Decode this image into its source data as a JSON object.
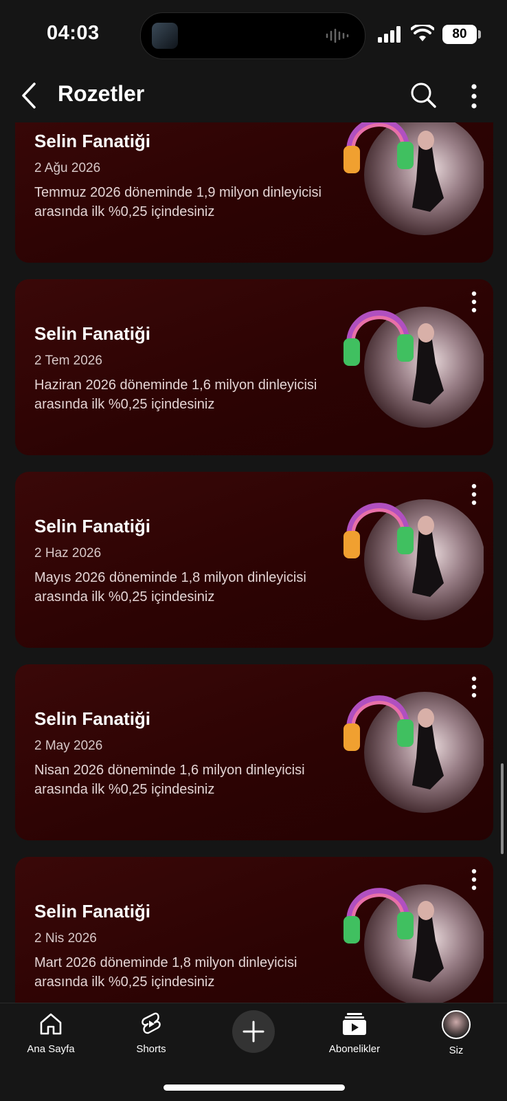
{
  "status_bar": {
    "time": "04:03",
    "battery": "80"
  },
  "header": {
    "title": "Rozetler",
    "back_icon": "chevron-left-icon",
    "search_icon": "search-icon",
    "more_icon": "more-vertical-icon"
  },
  "badges": [
    {
      "title": "Selin Fanatiği",
      "date": "2 Ağu 2026",
      "description": "Temmuz 2026 döneminde 1,9 milyon dinleyicisi arasında ilk %0,25 içindesiniz"
    },
    {
      "title": "Selin Fanatiği",
      "date": "2 Tem 2026",
      "description": "Haziran 2026 döneminde 1,6 milyon dinleyicisi arasında ilk %0,25 içindesiniz"
    },
    {
      "title": "Selin Fanatiği",
      "date": "2 Haz 2026",
      "description": "Mayıs 2026 döneminde 1,8 milyon dinleyicisi arasında ilk %0,25 içindesiniz"
    },
    {
      "title": "Selin Fanatiği",
      "date": "2 May 2026",
      "description": "Nisan 2026 döneminde 1,6 milyon dinleyicisi arasında ilk %0,25 içindesiniz"
    },
    {
      "title": "Selin Fanatiği",
      "date": "2 Nis 2026",
      "description": "Mart 2026 döneminde 1,8 milyon dinleyicisi arasında ilk %0,25 içindesiniz"
    }
  ],
  "nav": {
    "home": "Ana Sayfa",
    "shorts": "Shorts",
    "subscriptions": "Abonelikler",
    "you": "Siz"
  },
  "colors": {
    "card_bg": "#2c0303",
    "page_bg": "#151515"
  }
}
